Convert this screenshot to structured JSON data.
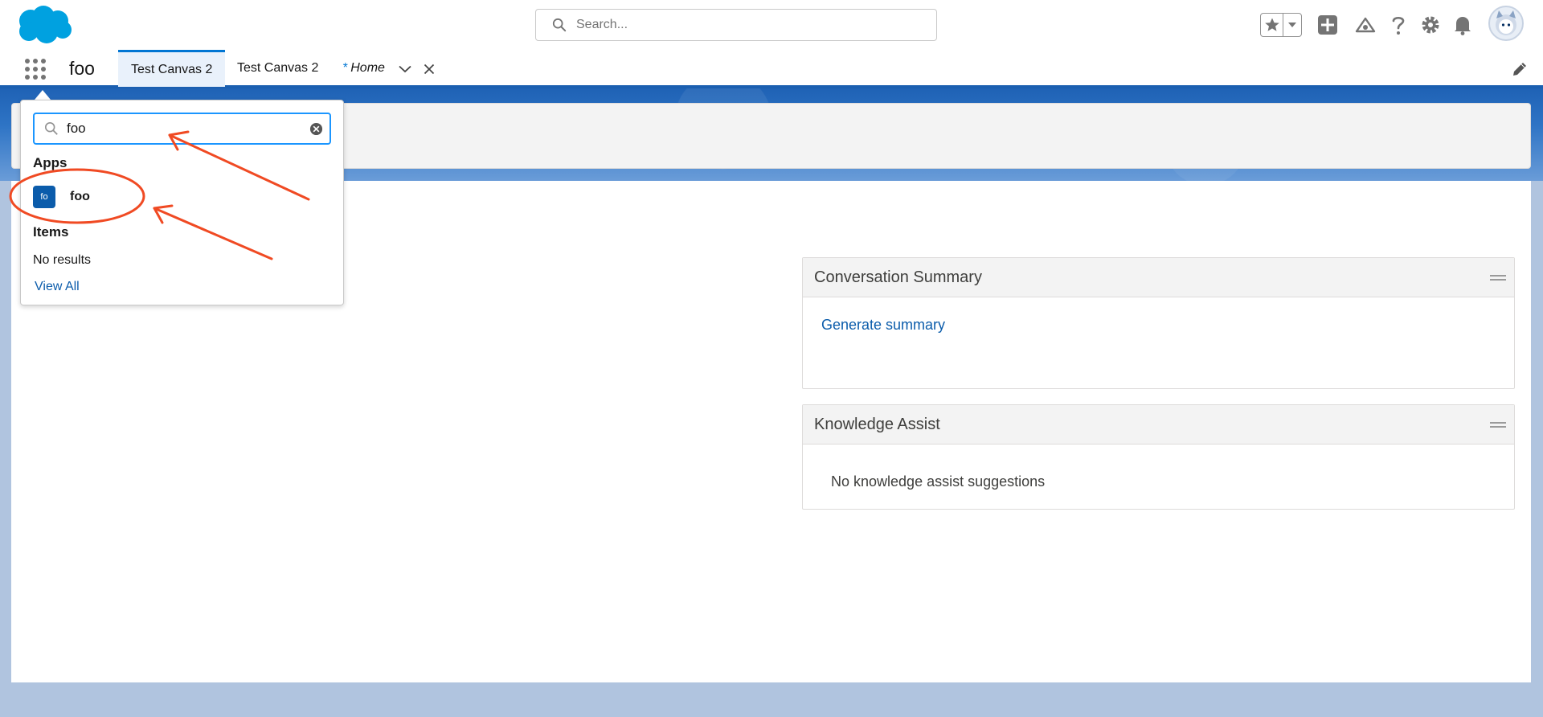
{
  "header": {
    "search_placeholder": "Search...",
    "brand_color": "#00a1e0"
  },
  "nav": {
    "app_name": "foo",
    "tabs": [
      {
        "label": "Test Canvas 2",
        "active": true
      },
      {
        "label": "Test Canvas 2",
        "active": false
      }
    ],
    "home_tab": {
      "prefix": "*",
      "label": "Home"
    }
  },
  "launcher": {
    "search_value": "foo",
    "apps_heading": "Apps",
    "app_result": {
      "tile_text": "fo",
      "label": "foo"
    },
    "items_heading": "Items",
    "no_results": "No results",
    "view_all": "View All"
  },
  "cards": {
    "conversation_summary": {
      "title": "Conversation Summary",
      "link": "Generate summary"
    },
    "knowledge_assist": {
      "title": "Knowledge Assist",
      "empty_text": "No knowledge assist suggestions"
    }
  },
  "annotation_color": "#f04a23"
}
